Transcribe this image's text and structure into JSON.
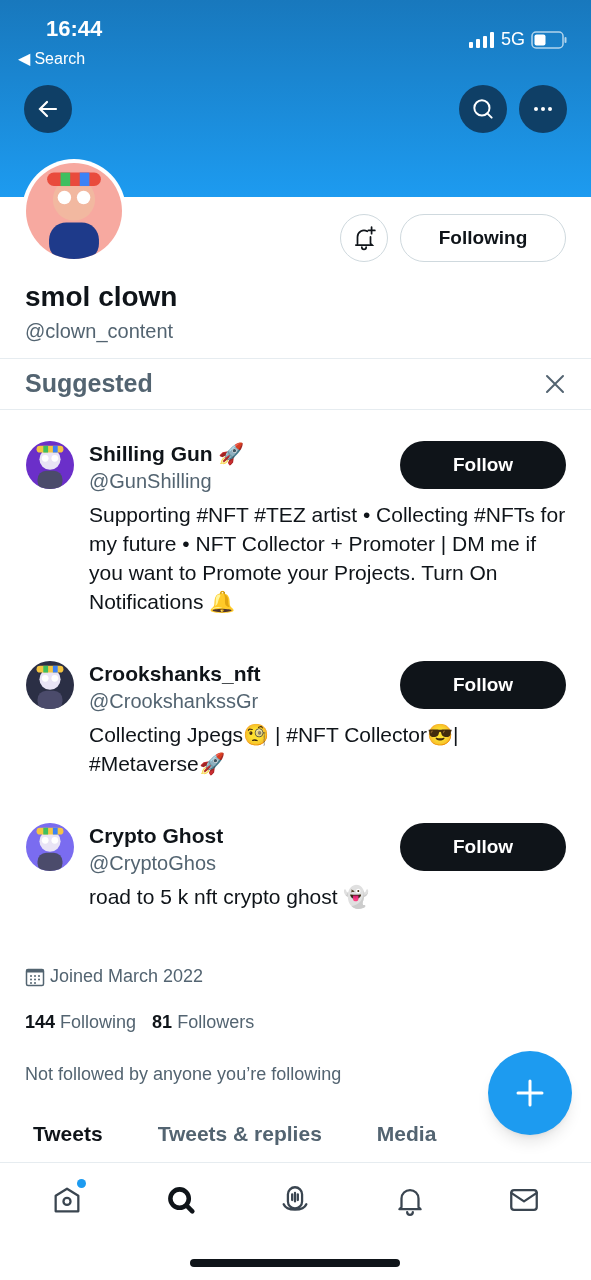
{
  "status_bar": {
    "time": "16:44",
    "back_label": "◀ Search",
    "network": "5G"
  },
  "profile": {
    "name": "smol clown",
    "handle": "@clown_content",
    "following_button": "Following",
    "joined": "Joined March 2022",
    "following_count": "144",
    "following_label": "Following",
    "followers_count": "81",
    "followers_label": "Followers",
    "followed_by": "Not followed by anyone you’re following"
  },
  "suggested": {
    "title": "Suggested",
    "accounts": [
      {
        "name": "Shilling Gun 🚀",
        "handle": "@GunShilling",
        "bio": "Supporting #NFT #TEZ artist • Collecting #NFTs for my future • NFT Collector + Promoter | DM me if you want to Promote your Projects. Turn On Notifications 🔔",
        "button": "Follow"
      },
      {
        "name": "Crookshanks_nft",
        "handle": "@CrookshankssGr",
        "bio": "Collecting Jpegs🧐 | #NFT Collector😎| #Metaverse🚀",
        "button": "Follow"
      },
      {
        "name": "Crypto Ghost",
        "handle": "@CryptoGhos",
        "bio": "road to 5 k nft crypto ghost 👻",
        "button": "Follow"
      }
    ]
  },
  "tabs": [
    {
      "label": "Tweets",
      "selected": true
    },
    {
      "label": "Tweets & replies",
      "selected": false
    },
    {
      "label": "Media",
      "selected": false
    }
  ],
  "nav": [
    {
      "kind": "home",
      "selected": false,
      "badge": true
    },
    {
      "kind": "search",
      "selected": true,
      "badge": false
    },
    {
      "kind": "spaces",
      "selected": false,
      "badge": false
    },
    {
      "kind": "notifications",
      "selected": false,
      "badge": false
    },
    {
      "kind": "messages",
      "selected": false,
      "badge": false
    }
  ]
}
